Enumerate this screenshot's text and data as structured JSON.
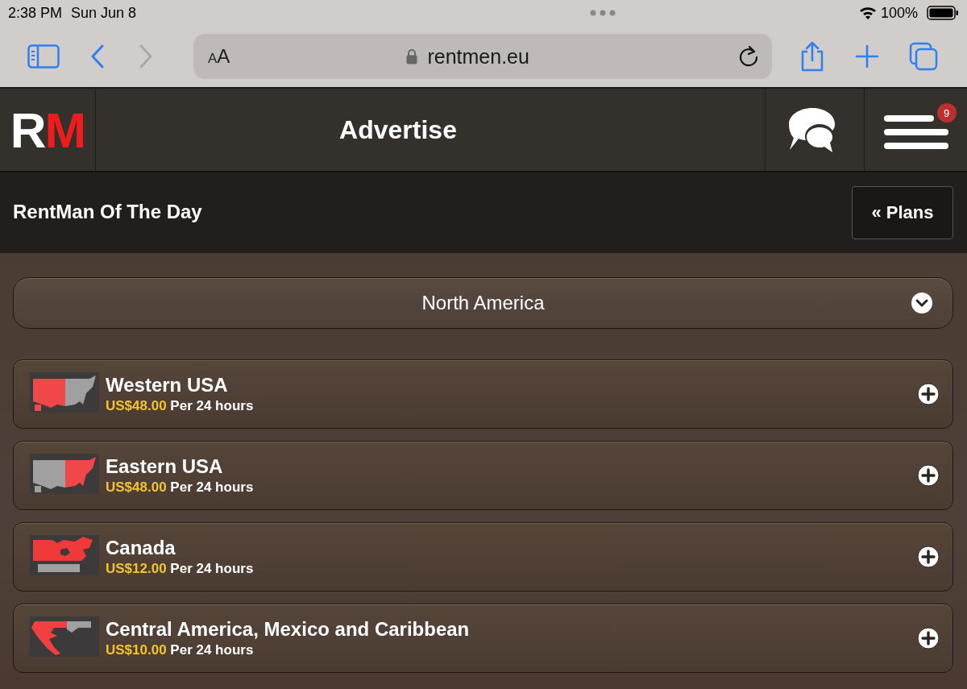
{
  "status_bar": {
    "time": "2:38 PM",
    "date": "Sun Jun 8",
    "battery": "100%"
  },
  "browser": {
    "text_size": "AA",
    "url": "rentmen.eu",
    "forward_disabled": true
  },
  "header": {
    "logo": [
      "R",
      "M"
    ],
    "title": "Advertise",
    "menu_badge": "9"
  },
  "subheader": {
    "title": "RentMan Of The Day",
    "button": "« Plans"
  },
  "region_select": {
    "value": "North America"
  },
  "plans": [
    {
      "name": "Western USA",
      "price": "US$48.00",
      "period": "Per 24 hours",
      "kind": "west"
    },
    {
      "name": "Eastern USA",
      "price": "US$48.00",
      "period": "Per 24 hours",
      "kind": "east"
    },
    {
      "name": "Canada",
      "price": "US$12.00",
      "period": "Per 24 hours",
      "kind": "canada"
    },
    {
      "name": "Central America, Mexico and Caribbean",
      "price": "US$10.00",
      "period": "Per 24 hours",
      "kind": "central"
    }
  ]
}
